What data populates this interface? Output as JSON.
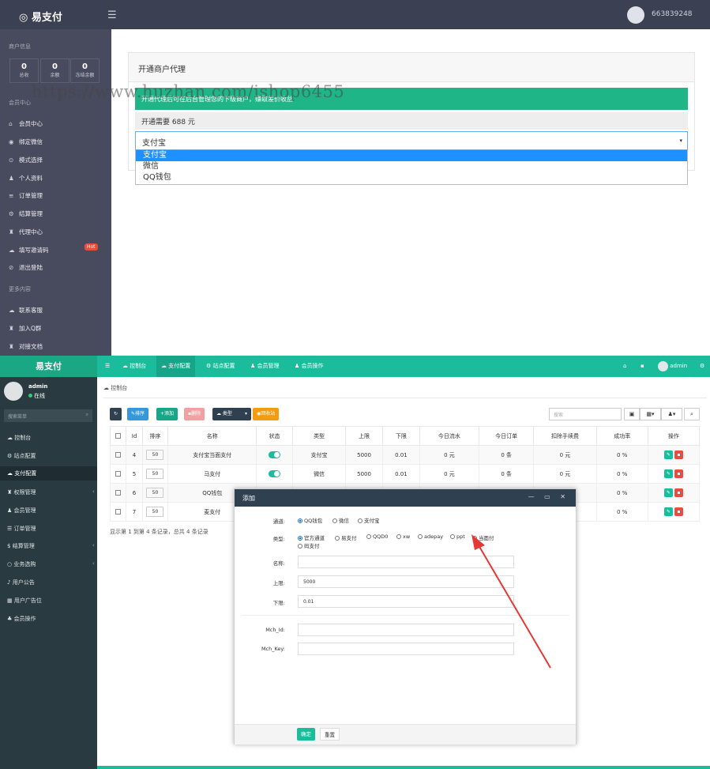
{
  "top": {
    "logo": "易支付",
    "menu_icon": "menu-icon",
    "user_id": "663839248",
    "sidebar": {
      "section_merchant": "商户信息",
      "stats": [
        {
          "value": "0",
          "label": "总收"
        },
        {
          "value": "0",
          "label": "余额"
        },
        {
          "value": "0",
          "label": "冻结余额"
        }
      ],
      "section_member": "会员中心",
      "items": [
        {
          "icon": "home-icon",
          "glyph": "⌂",
          "label": "会员中心"
        },
        {
          "icon": "wechat-icon",
          "glyph": "◉",
          "label": "绑定微信"
        },
        {
          "icon": "mode-icon",
          "glyph": "⊙",
          "label": "模式选择"
        },
        {
          "icon": "user-icon",
          "glyph": "♟",
          "label": "个人资料"
        },
        {
          "icon": "list-icon",
          "glyph": "≡",
          "label": "订单管理"
        },
        {
          "icon": "settle-icon",
          "glyph": "⚙",
          "label": "结算管理"
        },
        {
          "icon": "agent-icon",
          "glyph": "♜",
          "label": "代理中心"
        },
        {
          "icon": "invite-icon",
          "glyph": "☁",
          "label": "填写邀请码",
          "badge": "Hot"
        },
        {
          "icon": "logout-icon",
          "glyph": "⊘",
          "label": "退出登陆"
        }
      ],
      "section_more": "更多内容",
      "more_items": [
        {
          "icon": "support-icon",
          "glyph": "☁",
          "label": "联系客服"
        },
        {
          "icon": "group-icon",
          "glyph": "♜",
          "label": "加入Q群"
        },
        {
          "icon": "doc-icon",
          "glyph": "♜",
          "label": "对接文档"
        }
      ]
    },
    "panel": {
      "title": "开通商户代理",
      "notice": "开通代理后可在后台管理您的下级商户，赚取差价收益",
      "fee": "开通需要 688 元",
      "select_value": "支付宝",
      "options": [
        "支付宝",
        "微信",
        "QQ钱包"
      ]
    },
    "watermark": "https://www.huzhan.com/ishop6455"
  },
  "bottom": {
    "logo": "易支付",
    "nav": [
      {
        "icon": "dashboard-icon",
        "label": "控制台"
      },
      {
        "icon": "cloud-icon",
        "label": "支付配置",
        "active": true
      },
      {
        "icon": "gear-icon",
        "label": "站点配置"
      },
      {
        "icon": "user-icon",
        "label": "会员管理"
      },
      {
        "icon": "user-icon",
        "label": "会员操作"
      }
    ],
    "right_user": "admin",
    "user": {
      "name": "admin",
      "status": "在线"
    },
    "search_placeholder": "搜索菜单",
    "side": [
      {
        "icon": "dashboard-icon",
        "glyph": "☁",
        "label": "控制台"
      },
      {
        "icon": "gear-icon",
        "glyph": "⚙",
        "label": "站点配置"
      },
      {
        "icon": "cloud-icon",
        "glyph": "☁",
        "label": "支付配置",
        "active": true
      },
      {
        "icon": "plugin-icon",
        "glyph": "♜",
        "label": "权限管理",
        "chevron": "‹"
      },
      {
        "icon": "user-icon",
        "glyph": "♟",
        "label": "会员管理"
      },
      {
        "icon": "order-icon",
        "glyph": "☰",
        "label": "订单管理"
      },
      {
        "icon": "dollar-icon",
        "glyph": "$",
        "label": "结算管理",
        "chevron": "‹"
      },
      {
        "icon": "circle-icon",
        "glyph": "○",
        "label": "业务选购",
        "chevron": "‹"
      },
      {
        "icon": "bell-icon",
        "glyph": "♪",
        "label": "用户公告"
      },
      {
        "icon": "ad-icon",
        "glyph": "▦",
        "label": "用户广告位"
      },
      {
        "icon": "users-icon",
        "glyph": "♣",
        "label": "会员操作"
      }
    ],
    "breadcrumb": "控制台",
    "toolbar": {
      "refresh": "↻",
      "sort": "排序",
      "add": "添加",
      "delete": "删除",
      "type": "类型",
      "recycle": "回收站"
    },
    "search": "搜索",
    "table": {
      "headers": [
        "Id",
        "排序",
        "名称",
        "状态",
        "类型",
        "上限",
        "下限",
        "今日流水",
        "今日订单",
        "扣除手续费",
        "成功率",
        "操作"
      ],
      "rows": [
        {
          "id": "4",
          "sort": "50",
          "name": "支付宝当面支付",
          "type": "支付宝",
          "max": "5000",
          "min": "0.01",
          "flow": "0 元",
          "orders": "0 条",
          "fee": "0 元",
          "rate": "0 %"
        },
        {
          "id": "5",
          "sort": "50",
          "name": "马支付",
          "type": "微信",
          "max": "5000",
          "min": "0.01",
          "flow": "0 元",
          "orders": "0 条",
          "fee": "0 元",
          "rate": "0 %"
        },
        {
          "id": "6",
          "sort": "50",
          "name": "QQ钱包",
          "type": "",
          "max": "",
          "min": "",
          "flow": "",
          "orders": "",
          "fee": "0 元",
          "rate": "0 %"
        },
        {
          "id": "7",
          "sort": "50",
          "name": "麦支付",
          "type": "",
          "max": "",
          "min": "",
          "flow": "",
          "orders": "",
          "fee": "0 元",
          "rate": "0 %"
        }
      ]
    },
    "pager": "显示第 1 到第 4 条记录，总共 4 条记录"
  },
  "modal": {
    "title": "添加",
    "controls": "— ▭ ✕",
    "labels": {
      "channel": "通道:",
      "type": "类型:",
      "name": "名称:",
      "max": "上限:",
      "min": "下限:",
      "mch_id": "Mch_Id:",
      "mch_key": "Mch_Key:"
    },
    "channels": [
      "QQ钱包",
      "微信",
      "支付宝"
    ],
    "types": [
      "官方通道",
      "易支付",
      "QQD0",
      "xw",
      "adepay",
      "ppt",
      "当面付",
      "码支付"
    ],
    "max_value": "5000",
    "min_value": "0.01",
    "ok": "确定",
    "reset": "重置"
  }
}
